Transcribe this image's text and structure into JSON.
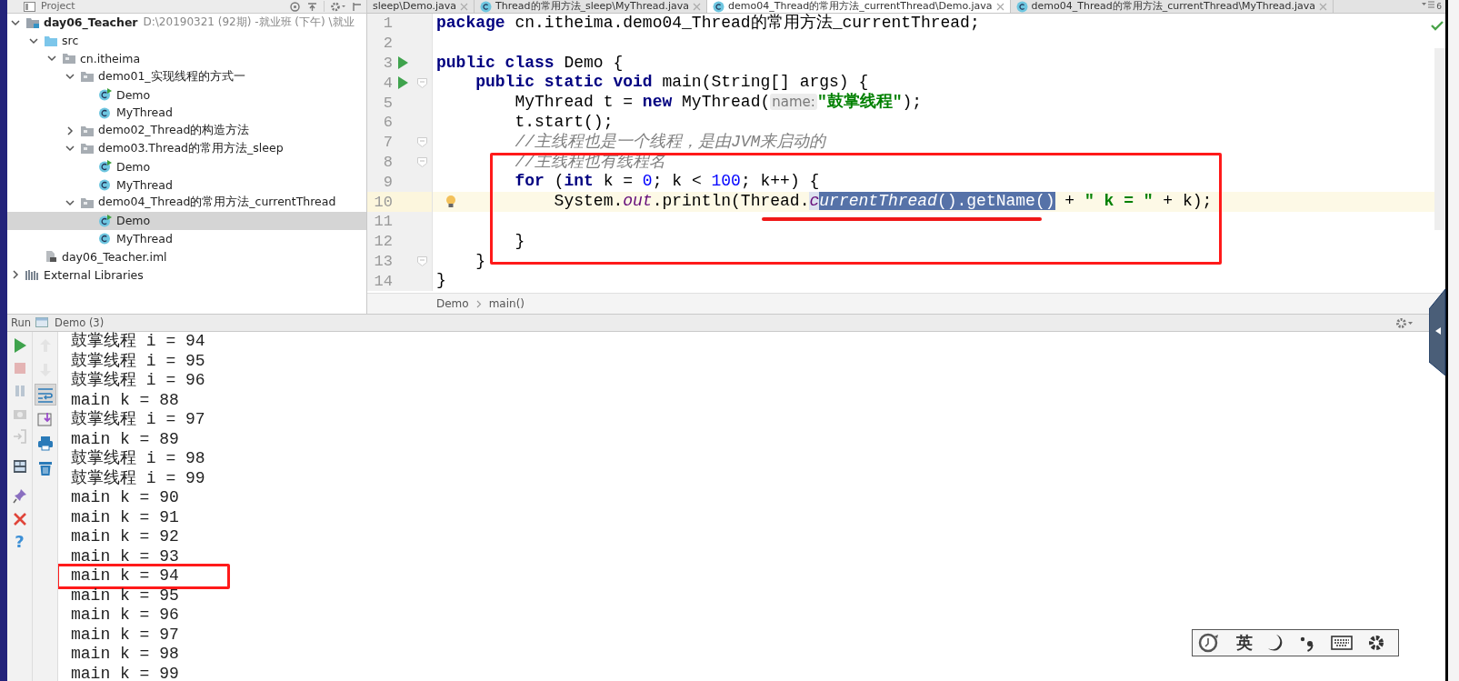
{
  "project_panel": {
    "title": "Project"
  },
  "project_tree": [
    {
      "label": "day06_Teacher",
      "path": "D:\\20190321 (92期) -就业班 (下午) \\就业",
      "kind": "module",
      "expanded": true,
      "selected": false,
      "children": [
        {
          "label": "src",
          "kind": "source",
          "expanded": true,
          "selected": false,
          "children": [
            {
              "label": "cn.itheima",
              "kind": "package",
              "expanded": true,
              "selected": false,
              "children": [
                {
                  "label": "demo01_实现线程的方式一",
                  "kind": "package",
                  "expanded": true,
                  "selected": false,
                  "children": [
                    {
                      "label": "Demo",
                      "kind": "class-main",
                      "selected": false
                    },
                    {
                      "label": "MyThread",
                      "kind": "class",
                      "selected": false
                    }
                  ]
                },
                {
                  "label": "demo02_Thread的构造方法",
                  "kind": "package",
                  "expanded": false,
                  "selected": false
                },
                {
                  "label": "demo03.Thread的常用方法_sleep",
                  "kind": "package",
                  "expanded": true,
                  "selected": false,
                  "children": [
                    {
                      "label": "Demo",
                      "kind": "class-main",
                      "selected": false
                    },
                    {
                      "label": "MyThread",
                      "kind": "class",
                      "selected": false
                    }
                  ]
                },
                {
                  "label": "demo04_Thread的常用方法_currentThread",
                  "kind": "package",
                  "expanded": true,
                  "selected": false,
                  "children": [
                    {
                      "label": "Demo",
                      "kind": "class-main",
                      "selected": true
                    },
                    {
                      "label": "MyThread",
                      "kind": "class",
                      "selected": false
                    }
                  ]
                }
              ]
            }
          ]
        },
        {
          "label": "day06_Teacher.iml",
          "kind": "file",
          "selected": false
        }
      ]
    },
    {
      "label": "External Libraries",
      "kind": "libraries",
      "expanded": false,
      "selected": false
    }
  ],
  "editor_tabs": [
    {
      "label": "sleep\\Demo.java",
      "file_icon": false,
      "selected": false
    },
    {
      "label": "Thread的常用方法_sleep\\MyThread.java",
      "file_icon": true,
      "selected": false
    },
    {
      "label": "demo04_Thread的常用方法_currentThread\\Demo.java",
      "file_icon": true,
      "selected": true
    },
    {
      "label": "demo04_Thread的常用方法_currentThread\\MyThread.java",
      "file_icon": true,
      "selected": false
    }
  ],
  "hidden_tabs": "6",
  "code": {
    "lines": [
      {
        "number": "1",
        "run_marker": false,
        "fold_marker": false,
        "current": false,
        "intention_bulb": false,
        "tokens": [
          {
            "kind": "kw",
            "text": "package"
          },
          {
            "kind": "plain",
            "text": " cn.itheima.demo04_Thread的常用方法_currentThread;"
          }
        ]
      },
      {
        "number": "2",
        "run_marker": false,
        "fold_marker": false,
        "current": false,
        "intention_bulb": false
      },
      {
        "number": "3",
        "run_marker": true,
        "fold_marker": false,
        "current": false,
        "intention_bulb": false,
        "tokens": [
          {
            "kind": "kw",
            "text": "public class"
          },
          {
            "kind": "plain",
            "text": " Demo {"
          }
        ]
      },
      {
        "number": "4",
        "run_marker": true,
        "fold_marker": true,
        "current": false,
        "intention_bulb": false,
        "tokens": [
          {
            "kind": "kw",
            "text": "    public static void"
          },
          {
            "kind": "plain",
            "text": " main(String[] args) {"
          }
        ]
      },
      {
        "number": "5",
        "run_marker": false,
        "fold_marker": false,
        "current": false,
        "intention_bulb": false,
        "tokens": [
          {
            "kind": "plain",
            "text": "        MyThread t = "
          },
          {
            "kind": "kw",
            "text": "new"
          },
          {
            "kind": "plain",
            "text": " MyThread("
          },
          {
            "kind": "hint",
            "text": "name:"
          },
          {
            "kind": "str",
            "text": "\"鼓掌线程\""
          },
          {
            "kind": "plain",
            "text": ");"
          }
        ]
      },
      {
        "number": "6",
        "run_marker": false,
        "fold_marker": false,
        "current": false,
        "intention_bulb": false,
        "tokens": [
          {
            "kind": "plain",
            "text": "        t.start();"
          }
        ]
      },
      {
        "number": "7",
        "run_marker": false,
        "fold_marker": true,
        "current": false,
        "intention_bulb": false,
        "tokens": [
          {
            "kind": "comment",
            "text": "        //主线程也是一个线程，是由JVM来启动的"
          }
        ]
      },
      {
        "number": "8",
        "run_marker": false,
        "fold_marker": true,
        "current": false,
        "intention_bulb": false,
        "tokens": [
          {
            "kind": "comment",
            "text": "        //主线程也有线程名"
          }
        ]
      },
      {
        "number": "9",
        "run_marker": false,
        "fold_marker": false,
        "current": false,
        "intention_bulb": false,
        "tokens": [
          {
            "kind": "kw",
            "text": "        for"
          },
          {
            "kind": "plain",
            "text": " ("
          },
          {
            "kind": "kw",
            "text": "int"
          },
          {
            "kind": "plain",
            "text": " k = "
          },
          {
            "kind": "num",
            "text": "0"
          },
          {
            "kind": "plain",
            "text": "; k < "
          },
          {
            "kind": "num",
            "text": "100"
          },
          {
            "kind": "plain",
            "text": "; k++) {"
          }
        ]
      },
      {
        "number": "10",
        "run_marker": false,
        "fold_marker": false,
        "current": true,
        "intention_bulb": true,
        "tokens": [
          {
            "kind": "plain",
            "text": "            System."
          },
          {
            "kind": "field",
            "text": "out"
          },
          {
            "kind": "plain",
            "text": ".println(Thread."
          },
          {
            "kind": "field-light",
            "text": "c"
          },
          {
            "kind": "sel-italic",
            "text": "urrentThread"
          },
          {
            "kind": "sel",
            "text": "().getName()"
          },
          {
            "kind": "plain",
            "text": " + "
          },
          {
            "kind": "str",
            "text": "\" k = \""
          },
          {
            "kind": "plain",
            "text": " + k);"
          }
        ]
      },
      {
        "number": "11",
        "run_marker": false,
        "fold_marker": false,
        "current": false,
        "intention_bulb": false
      },
      {
        "number": "12",
        "run_marker": false,
        "fold_marker": false,
        "current": false,
        "intention_bulb": false,
        "tokens": [
          {
            "kind": "plain",
            "text": "        }"
          }
        ]
      },
      {
        "number": "13",
        "run_marker": false,
        "fold_marker": true,
        "current": false,
        "intention_bulb": false,
        "tokens": [
          {
            "kind": "plain",
            "text": "    }"
          }
        ]
      },
      {
        "number": "14",
        "run_marker": false,
        "fold_marker": false,
        "current": false,
        "intention_bulb": false,
        "tokens": [
          {
            "kind": "plain",
            "text": "}"
          }
        ]
      }
    ]
  },
  "breadcrumb": [
    "Demo",
    "main()"
  ],
  "run_panel": {
    "title": "Run",
    "tab": "Demo (3)",
    "left_tools": [
      {
        "kind": "run",
        "disabled": false
      },
      {
        "kind": "stop",
        "disabled": true
      },
      {
        "kind": "pause",
        "disabled": true
      },
      {
        "kind": "snapshot",
        "disabled": true
      },
      {
        "kind": "exit",
        "disabled": true
      },
      {
        "kind": "layout",
        "disabled": false
      },
      {
        "kind": "pin",
        "disabled": false
      },
      {
        "kind": "close",
        "disabled": false
      },
      {
        "kind": "help",
        "glyph": "?",
        "disabled": false
      }
    ],
    "right_tools": [
      {
        "kind": "up",
        "on": false,
        "disabled": true
      },
      {
        "kind": "down",
        "on": false,
        "disabled": true
      },
      {
        "kind": "wrap",
        "on": true,
        "disabled": false
      },
      {
        "kind": "scroll-end",
        "on": false,
        "disabled": false
      },
      {
        "kind": "print",
        "on": false,
        "disabled": false
      },
      {
        "kind": "trash",
        "on": false,
        "disabled": false
      }
    ],
    "output": [
      "鼓掌线程 i = 94",
      "鼓掌线程 i = 95",
      "鼓掌线程 i = 96",
      "main k = 88",
      "鼓掌线程 i = 97",
      "main k = 89",
      "鼓掌线程 i = 98",
      "鼓掌线程 i = 99",
      "main k = 90",
      "main k = 91",
      "main k = 92",
      "main k = 93",
      "main k = 94",
      "main k = 95",
      "main k = 96",
      "main k = 97",
      "main k = 98",
      "main k = 99"
    ]
  },
  "ime_bar": {
    "mode": "英"
  }
}
